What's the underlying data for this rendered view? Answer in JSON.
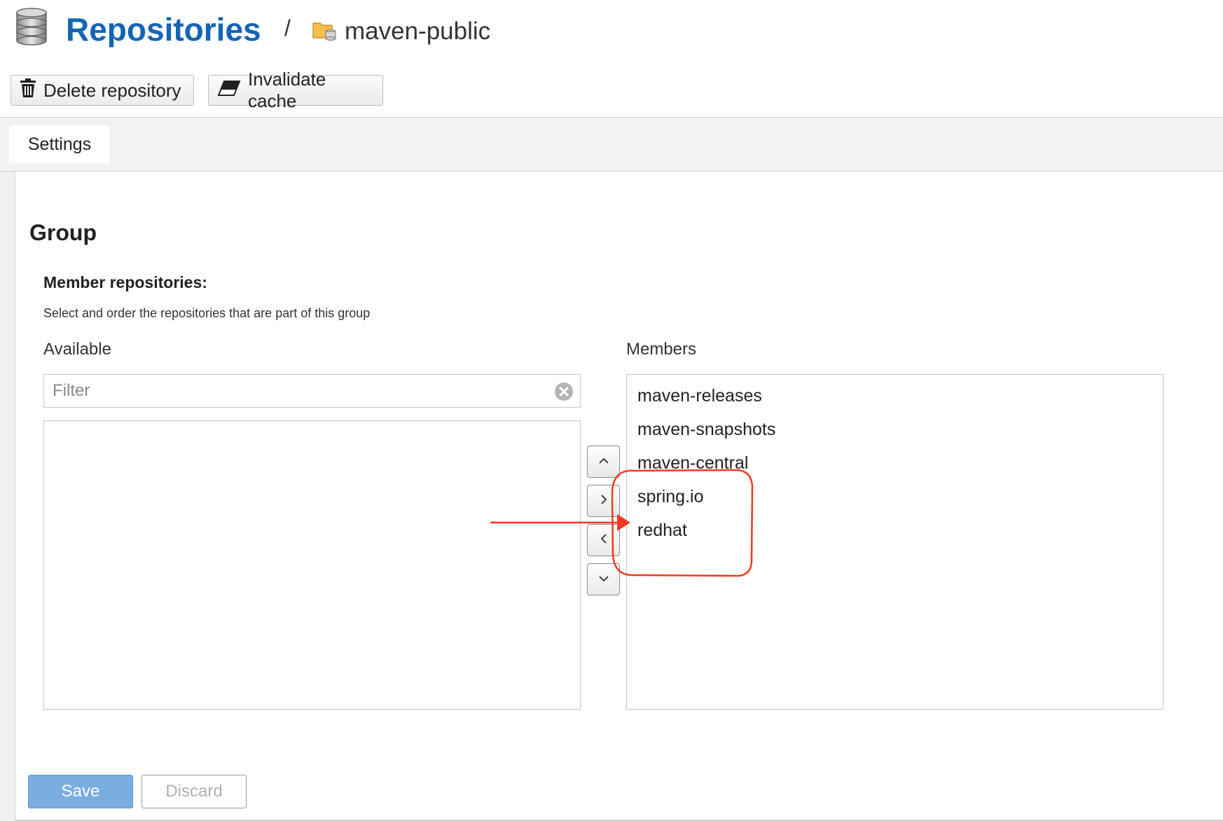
{
  "header": {
    "title": "Repositories",
    "separator": "/",
    "repo_name": "maven-public",
    "icons": {
      "title": "database-icon",
      "repo": "folder-repo-icon"
    },
    "accent_color": "#1565b5"
  },
  "toolbar": {
    "delete_label": "Delete repository",
    "invalidate_label": "Invalidate cache",
    "icons": {
      "delete": "trash-icon",
      "invalidate": "eraser-icon"
    }
  },
  "tabs": [
    {
      "label": "Settings",
      "active": true
    }
  ],
  "group": {
    "heading": "Group",
    "member_label": "Member repositories:",
    "member_description": "Select and order the repositories that are part of this group",
    "available_label": "Available",
    "members_label": "Members",
    "filter_placeholder": "Filter",
    "available_items": [],
    "members": [
      "maven-releases",
      "maven-snapshots",
      "maven-central",
      "spring.io",
      "redhat"
    ],
    "move_buttons": [
      "chevron-up-icon",
      "chevron-right-icon",
      "chevron-left-icon",
      "chevron-down-icon"
    ]
  },
  "footer": {
    "save_label": "Save",
    "discard_label": "Discard",
    "save_color": "#7aaee0"
  },
  "annotation": {
    "color": "#f03a1f",
    "highlighted_members": [
      "spring.io",
      "redhat"
    ]
  }
}
